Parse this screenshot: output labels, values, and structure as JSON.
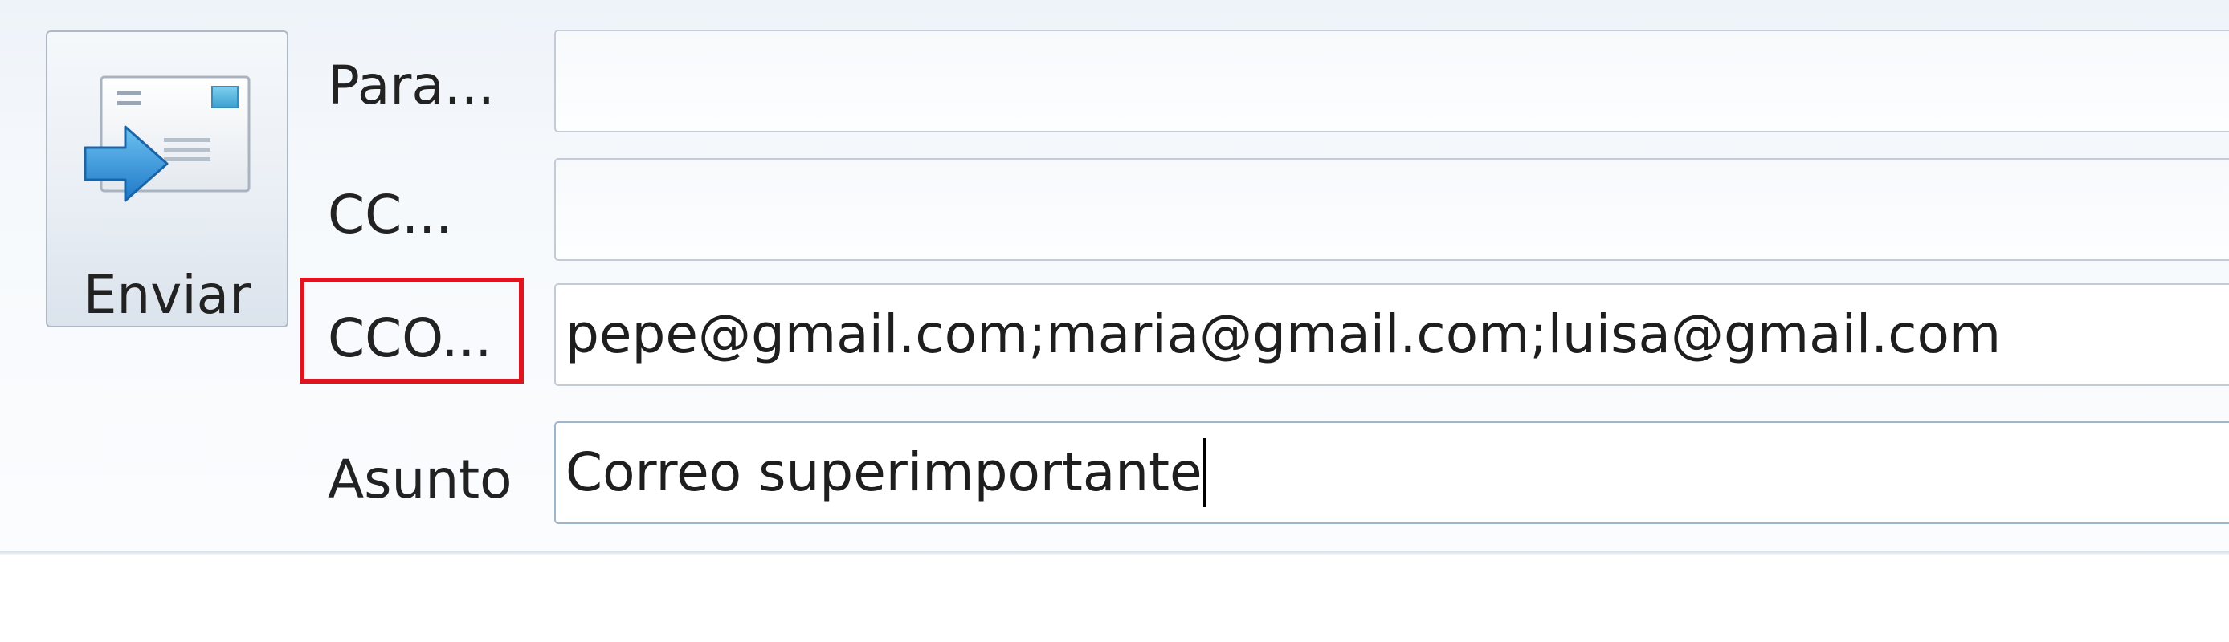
{
  "send_button": {
    "label": "Enviar",
    "icon": "send-mail-icon"
  },
  "fields": {
    "to": {
      "label": "Para...",
      "value": ""
    },
    "cc": {
      "label": "CC...",
      "value": ""
    },
    "bcc": {
      "label": "CCO...",
      "value": "pepe@gmail.com;maria@gmail.com;luisa@gmail.com",
      "highlighted": true
    },
    "subject": {
      "label": "Asunto",
      "value": "Correo superimportante",
      "focused": true
    }
  },
  "colors": {
    "highlight_border": "#e0141e",
    "envelope_accent": "#4aa8d8",
    "arrow": "#2f8fd6"
  }
}
